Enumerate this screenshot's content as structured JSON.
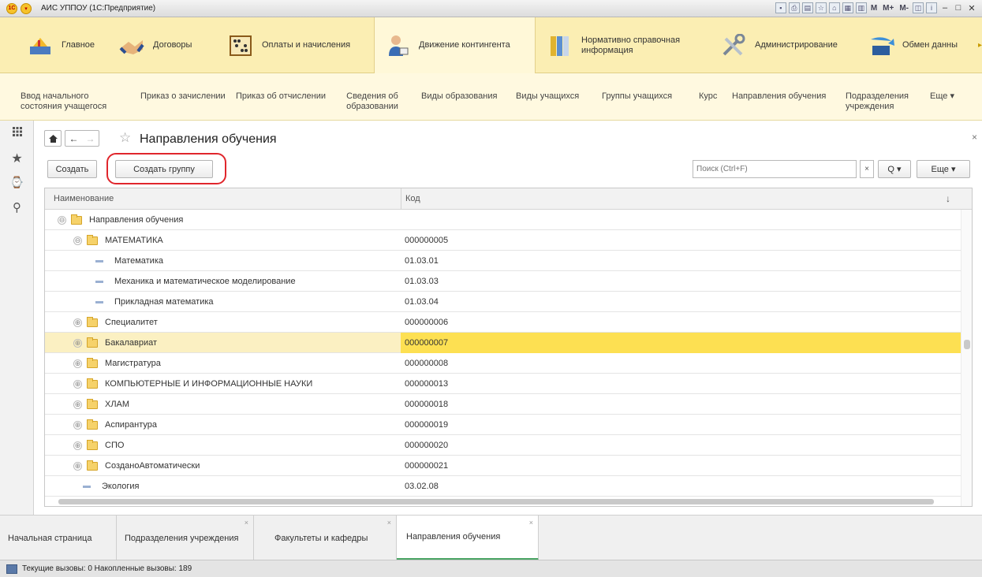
{
  "app": {
    "title": "АИС УППОУ (1С:Предприятие)"
  },
  "titlebar_tools": [
    "М",
    "М+",
    "М-"
  ],
  "sections": [
    {
      "label": "Главное"
    },
    {
      "label": "Договоры"
    },
    {
      "label": "Оплаты и начисления"
    },
    {
      "label": "Движение контингента"
    },
    {
      "label": "Нормативно справочная информация"
    },
    {
      "label": "Администрирование"
    },
    {
      "label": "Обмен данны"
    }
  ],
  "subnav": [
    {
      "label": "Ввод начального состояния учащегося"
    },
    {
      "label": "Приказ о зачислении"
    },
    {
      "label": "Приказ об отчислении"
    },
    {
      "label": "Сведения об образовании"
    },
    {
      "label": "Виды образования"
    },
    {
      "label": "Виды учащихся"
    },
    {
      "label": "Группы учащихся"
    },
    {
      "label": "Курс"
    },
    {
      "label": "Направления обучения"
    },
    {
      "label": "Подразделения учреждения"
    },
    {
      "label": "Еще ▾"
    }
  ],
  "page": {
    "title": "Направления обучения"
  },
  "toolbar": {
    "create_label": "Создать",
    "create_group_label": "Создать группу",
    "search_placeholder": "Поиск (Ctrl+F)",
    "search_clear": "×",
    "search_btn_label": "Q ▾",
    "more_label": "Еще  ▾"
  },
  "table": {
    "columns": [
      "Наименование",
      "Код"
    ],
    "sort_icon": "↓",
    "rows": [
      {
        "name": "Направления обучения",
        "code": "",
        "kind": "group",
        "expander": "⊖",
        "level": 0
      },
      {
        "name": "МАТЕМАТИКА",
        "code": "000000005",
        "kind": "group",
        "expander": "⊖",
        "level": 1
      },
      {
        "name": "Математика",
        "code": "01.03.01",
        "kind": "item",
        "level": 2
      },
      {
        "name": "Механика и математическое моделирование",
        "code": "01.03.03",
        "kind": "item",
        "level": 2
      },
      {
        "name": "Прикладная математика",
        "code": "01.03.04",
        "kind": "item",
        "level": 2
      },
      {
        "name": "Специалитет",
        "code": "000000006",
        "kind": "group",
        "expander": "⊕",
        "level": 1
      },
      {
        "name": "Бакалавриат",
        "code": "000000007",
        "kind": "group",
        "expander": "⊕",
        "level": 1,
        "selected": true
      },
      {
        "name": "Магистратура",
        "code": "000000008",
        "kind": "group",
        "expander": "⊕",
        "level": 1
      },
      {
        "name": "КОМПЬЮТЕРНЫЕ И ИНФОРМАЦИОННЫЕ НАУКИ",
        "code": "000000013",
        "kind": "group",
        "expander": "⊕",
        "level": 1
      },
      {
        "name": "ХЛАМ",
        "code": "000000018",
        "kind": "group",
        "expander": "⊕",
        "level": 1
      },
      {
        "name": "Аспирантура",
        "code": "000000019",
        "kind": "group",
        "expander": "⊕",
        "level": 1
      },
      {
        "name": "СПО",
        "code": "000000020",
        "kind": "group",
        "expander": "⊕",
        "level": 1
      },
      {
        "name": "СозданоАвтоматически",
        "code": "000000021",
        "kind": "group",
        "expander": "⊕",
        "level": 1
      },
      {
        "name": "Экология",
        "code": "03.02.08",
        "kind": "item",
        "level": 1
      }
    ]
  },
  "tabs": [
    {
      "label": "Начальная страница"
    },
    {
      "label": "Подразделения учреждения"
    },
    {
      "label": "Факультеты и кафедры"
    },
    {
      "label": "Направления обучения"
    }
  ],
  "status": {
    "text": "Текущие вызовы: 0  Накопленные вызовы: 189"
  },
  "colors": {
    "sections_bg": "#fbeeb3",
    "selection": "#fde052",
    "accent_tab": "#4aa564",
    "highlight_oval": "#e0262c"
  }
}
